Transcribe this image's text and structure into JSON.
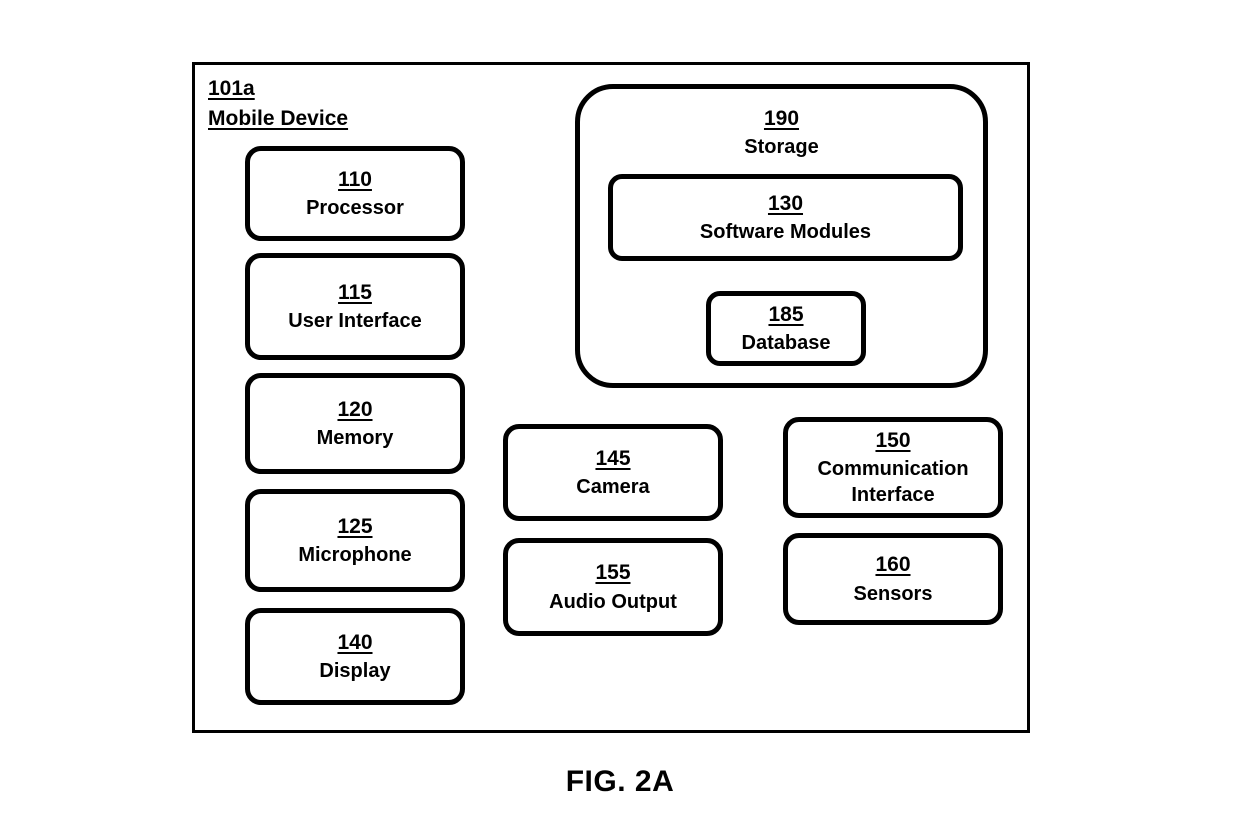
{
  "figure": {
    "caption": "FIG. 2A",
    "frame": {
      "ref": "101a",
      "name": "Mobile Device"
    }
  },
  "blocks": {
    "processor": {
      "ref": "110",
      "name": "Processor"
    },
    "user_interface": {
      "ref": "115",
      "name": "User Interface"
    },
    "memory": {
      "ref": "120",
      "name": "Memory"
    },
    "microphone": {
      "ref": "125",
      "name": "Microphone"
    },
    "display": {
      "ref": "140",
      "name": "Display"
    },
    "camera": {
      "ref": "145",
      "name": "Camera"
    },
    "audio_output": {
      "ref": "155",
      "name": "Audio Output"
    },
    "communication": {
      "ref": "150",
      "name": "Communication Interface"
    },
    "sensors": {
      "ref": "160",
      "name": "Sensors"
    },
    "storage": {
      "ref": "190",
      "name": "Storage"
    },
    "software_modules": {
      "ref": "130",
      "name": "Software Modules"
    },
    "database": {
      "ref": "185",
      "name": "Database"
    }
  },
  "colors": {
    "stroke": "#000000",
    "background": "#ffffff",
    "text": "#000000"
  }
}
